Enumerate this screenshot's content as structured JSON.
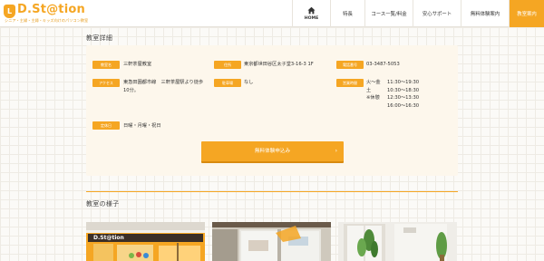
{
  "header": {
    "logo_mark": "L",
    "logo_text": "D.St@tion",
    "logo_sub": "シニア・主婦・主婦・キッズ向けのパソコン教室",
    "nav": [
      {
        "label": "HOME"
      },
      {
        "label": "特長"
      },
      {
        "label": "コース一覧/料金"
      },
      {
        "label": "安心サポート"
      },
      {
        "label": "無料体験案内"
      },
      {
        "label": "教室案内"
      }
    ]
  },
  "details": {
    "title": "教室詳細",
    "name_label": "教室名",
    "name_value": "三軒茶屋教室",
    "address_label": "住所",
    "address_value": "東京都世田谷区太子堂3-16-3 1F",
    "phone_label": "電話番号",
    "phone_value": "03-3487-5053",
    "access_label": "アクセス",
    "access_line1": "東急田園都市線　三軒茶屋駅より徒歩",
    "access_line2": "10分。",
    "parking_label": "駐車場",
    "parking_value": "なし",
    "hours_label": "営業時間",
    "hours": [
      {
        "day": "火～金",
        "time": "11:30～19:30"
      },
      {
        "day": "土",
        "time": "10:30～18:30"
      },
      {
        "day": "※休憩",
        "time": "12:30～13:30"
      },
      {
        "day": "",
        "time": "16:00～16:30"
      }
    ],
    "holiday_label": "定休日",
    "holiday_value": "日曜・月曜・祝日",
    "cta_label": "無料体験申込み",
    "cta_arrow": "›"
  },
  "gallery": {
    "title": "教室の様子",
    "sign_text": "D.St@tion"
  },
  "colors": {
    "accent": "#f5a623",
    "card_bg": "#fdf7ec"
  }
}
